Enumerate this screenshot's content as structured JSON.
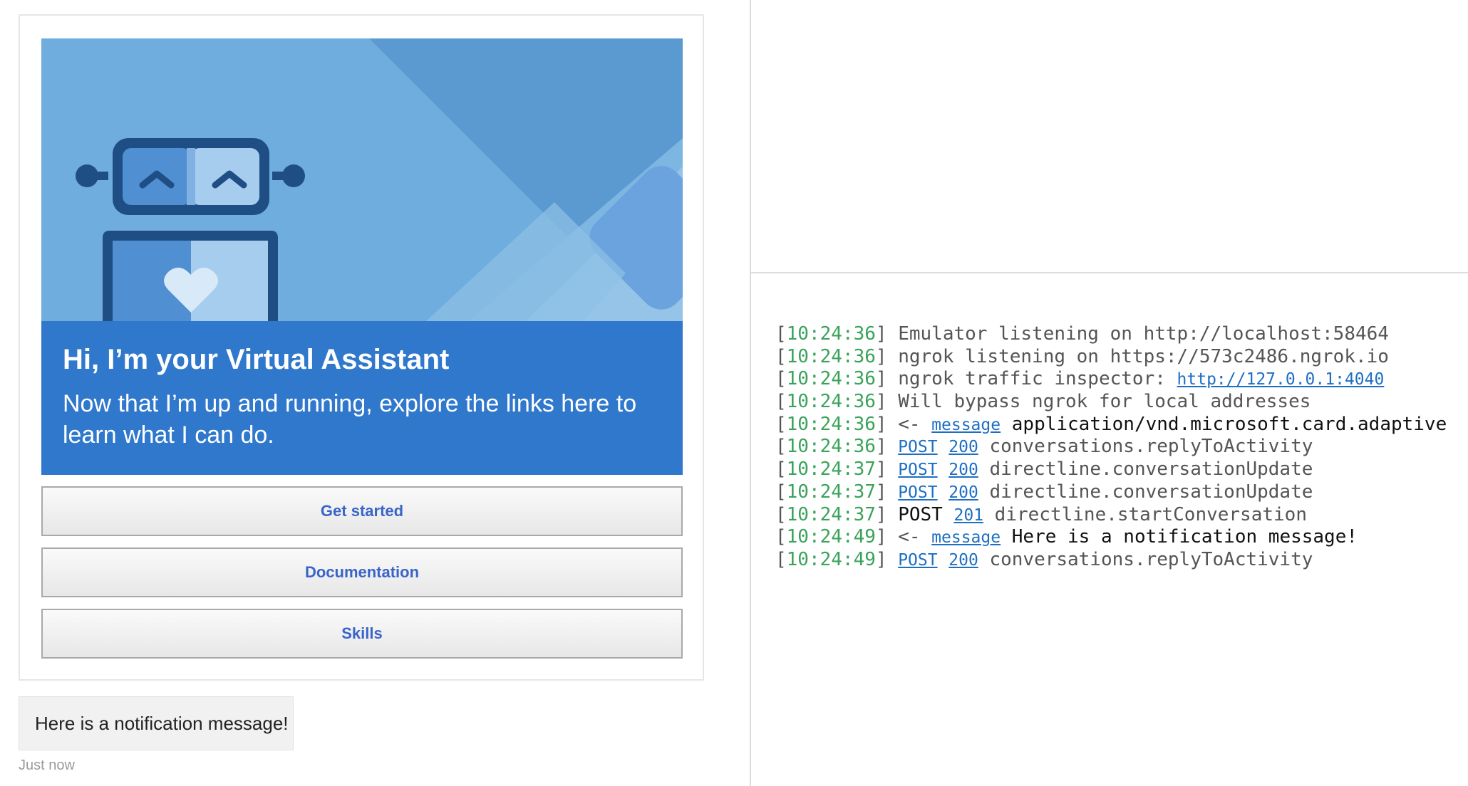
{
  "chat": {
    "card": {
      "title": "Hi, I’m your Virtual Assistant",
      "text": "Now that I’m up and running, explore the links here to learn what I can do.",
      "actions": [
        {
          "label": "Get started"
        },
        {
          "label": "Documentation"
        },
        {
          "label": "Skills"
        }
      ],
      "hero_colors": {
        "background": "#6fadde",
        "banner": "#2f78cc",
        "robot": "#1f4e84"
      }
    },
    "notification": {
      "text": "Here is a notification message!",
      "time": "Just now"
    }
  },
  "log": {
    "entries": [
      {
        "time": "10:24:36",
        "parts": [
          {
            "t": "text",
            "v": "Emulator listening on http://localhost:58464"
          }
        ]
      },
      {
        "time": "10:24:36",
        "parts": [
          {
            "t": "text",
            "v": "ngrok listening on https://573c2486.ngrok.io"
          }
        ]
      },
      {
        "time": "10:24:36",
        "parts": [
          {
            "t": "text",
            "v": "ngrok traffic inspector: "
          },
          {
            "t": "link",
            "v": "http://127.0.0.1:4040",
            "name": "inspector-link"
          }
        ]
      },
      {
        "time": "10:24:36",
        "parts": [
          {
            "t": "text",
            "v": "Will bypass ngrok for local addresses"
          }
        ]
      },
      {
        "time": "10:24:36",
        "parts": [
          {
            "t": "text",
            "v": "<- "
          },
          {
            "t": "link",
            "v": "message",
            "name": "message-link"
          },
          {
            "t": "dark",
            "v": " application/vnd.microsoft.card.adaptive"
          }
        ]
      },
      {
        "time": "10:24:36",
        "parts": [
          {
            "t": "link",
            "v": "POST",
            "name": "method-link"
          },
          {
            "t": "text",
            "v": " "
          },
          {
            "t": "link",
            "v": "200",
            "name": "status-link"
          },
          {
            "t": "text",
            "v": " conversations.replyToActivity"
          }
        ]
      },
      {
        "time": "10:24:37",
        "parts": [
          {
            "t": "link",
            "v": "POST",
            "name": "method-link"
          },
          {
            "t": "text",
            "v": " "
          },
          {
            "t": "link",
            "v": "200",
            "name": "status-link"
          },
          {
            "t": "text",
            "v": " directline.conversationUpdate"
          }
        ]
      },
      {
        "time": "10:24:37",
        "parts": [
          {
            "t": "link",
            "v": "POST",
            "name": "method-link"
          },
          {
            "t": "text",
            "v": " "
          },
          {
            "t": "link",
            "v": "200",
            "name": "status-link"
          },
          {
            "t": "text",
            "v": " directline.conversationUpdate"
          }
        ]
      },
      {
        "time": "10:24:37",
        "parts": [
          {
            "t": "dark",
            "v": "POST"
          },
          {
            "t": "text",
            "v": " "
          },
          {
            "t": "link",
            "v": "201",
            "name": "status-link"
          },
          {
            "t": "text",
            "v": " directline.startConversation"
          }
        ]
      },
      {
        "time": "10:24:49",
        "parts": [
          {
            "t": "text",
            "v": "<- "
          },
          {
            "t": "link",
            "v": "message",
            "name": "message-link"
          },
          {
            "t": "dark",
            "v": " Here is a notification message!"
          }
        ]
      },
      {
        "time": "10:24:49",
        "parts": [
          {
            "t": "link",
            "v": "POST",
            "name": "method-link"
          },
          {
            "t": "text",
            "v": " "
          },
          {
            "t": "link",
            "v": "200",
            "name": "status-link"
          },
          {
            "t": "text",
            "v": " conversations.replyToActivity"
          }
        ]
      }
    ]
  }
}
